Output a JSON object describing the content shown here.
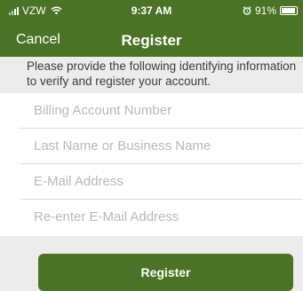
{
  "status_bar": {
    "carrier": "VZW",
    "time": "9:37 AM",
    "battery": "91%",
    "battery_level": 0.91
  },
  "nav": {
    "cancel_label": "Cancel",
    "title": "Register"
  },
  "instructions": "Please provide the following identifying information to verify and register your account.",
  "form": {
    "fields": [
      {
        "placeholder": "Billing Account Number",
        "value": ""
      },
      {
        "placeholder": "Last Name or Business Name",
        "value": ""
      },
      {
        "placeholder": "E-Mail Address",
        "value": ""
      },
      {
        "placeholder": "Re-enter E-Mail Address",
        "value": ""
      }
    ]
  },
  "register_button_label": "Register",
  "colors": {
    "brand_green": "#4a7325",
    "background": "#ececec",
    "field_background": "#ffffff",
    "placeholder": "#b9b9b9"
  },
  "icons": [
    "signal-icon",
    "wifi-icon",
    "alarm-icon",
    "battery-icon"
  ]
}
